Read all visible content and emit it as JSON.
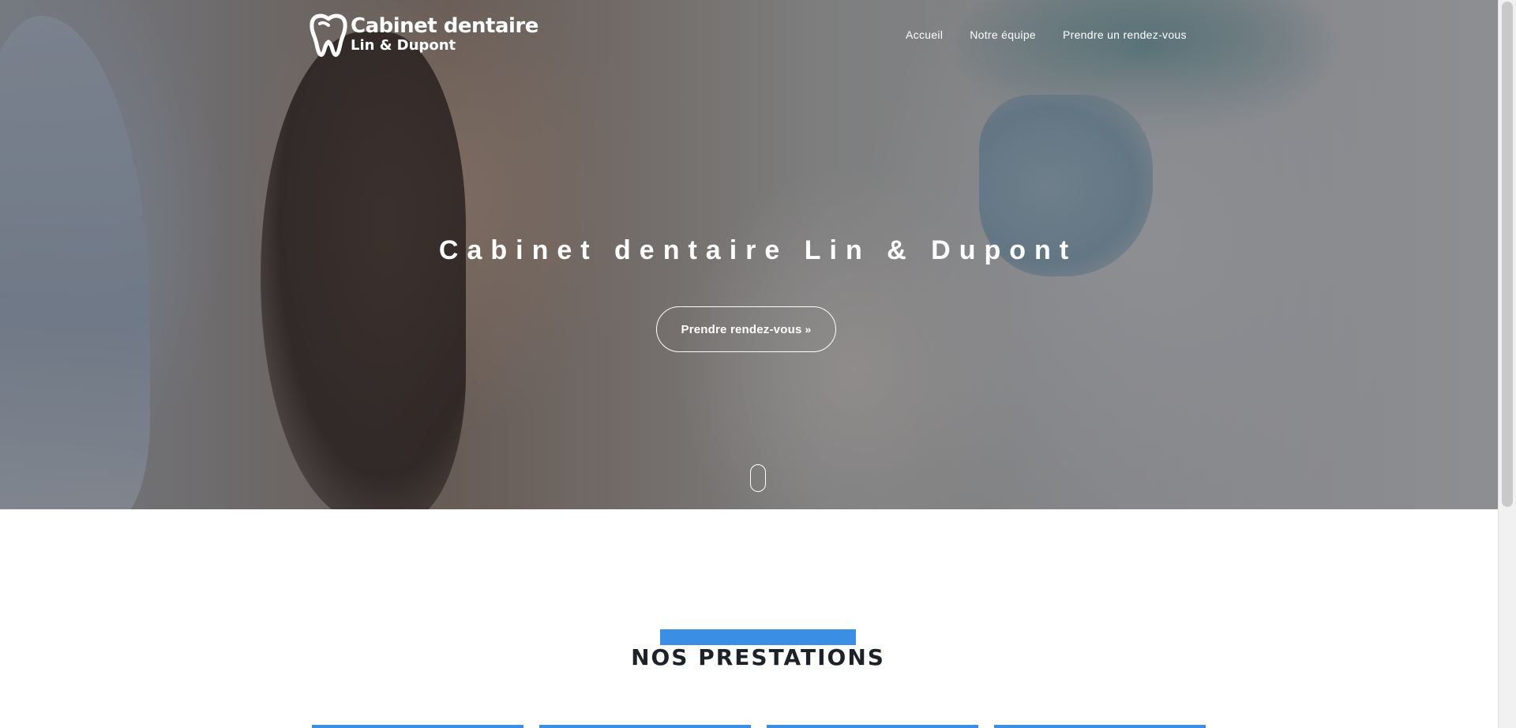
{
  "brand": {
    "line1": "Cabinet dentaire",
    "line2": "Lin & Dupont",
    "icon": "tooth-icon"
  },
  "nav": {
    "items": [
      {
        "label": "Accueil"
      },
      {
        "label": "Notre équipe"
      },
      {
        "label": "Prendre un rendez-vous"
      }
    ]
  },
  "hero": {
    "title": "Cabinet dentaire Lin & Dupont",
    "cta_label": "Prendre rendez-vous",
    "cta_icon": "double-chevron-right-icon",
    "scroll_icon": "mouse-scroll-icon"
  },
  "services": {
    "title": "NOS PRESTATIONS"
  },
  "colors": {
    "accent": "#3a8ee3",
    "heading": "#1d2228",
    "overlay": "#232328"
  }
}
